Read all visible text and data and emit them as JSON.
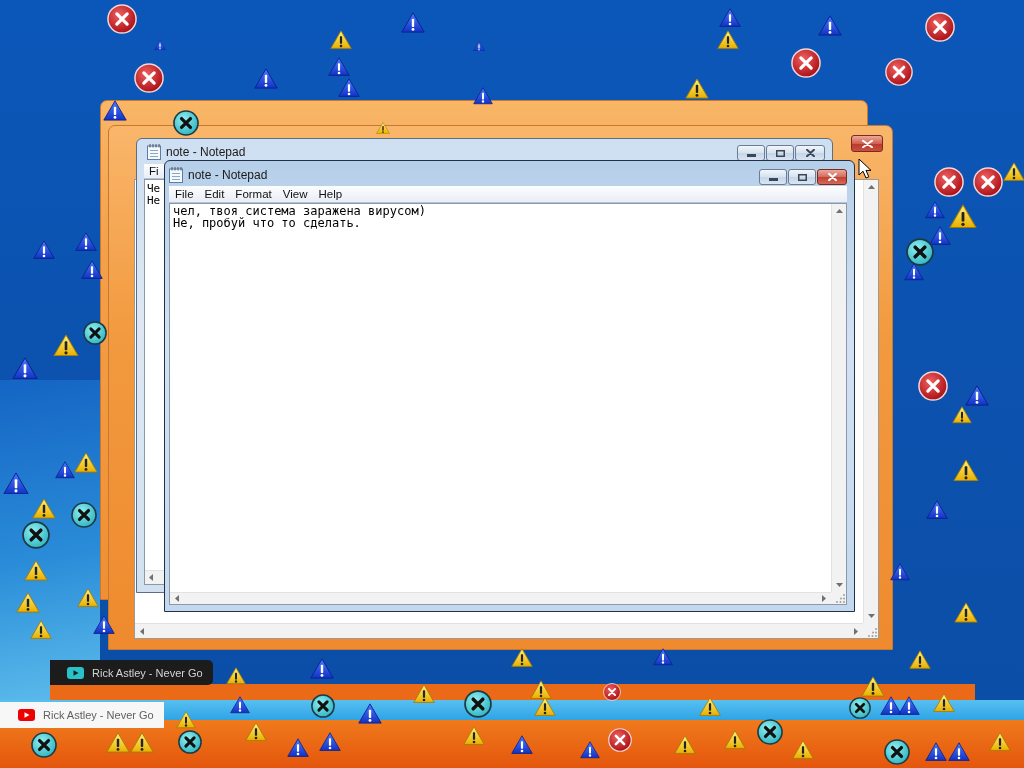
{
  "windows": [
    {
      "title": "note - Notepad",
      "active": false,
      "menu": [
        "Fi"
      ],
      "lines": [
        "Че",
        "Не"
      ]
    },
    {
      "title": "note - Notepad",
      "active": true,
      "menu": [
        "File",
        "Edit",
        "Format",
        "View",
        "Help"
      ],
      "lines": [
        "чел, твоя система заражена вирусом)",
        "Не, пробуй что то сделать."
      ]
    }
  ],
  "taskbar_previews": [
    {
      "kind": "dark",
      "label": "Rick Astley - Never Go"
    },
    {
      "kind": "light",
      "label": "Rick Astley - Never Go"
    }
  ]
}
